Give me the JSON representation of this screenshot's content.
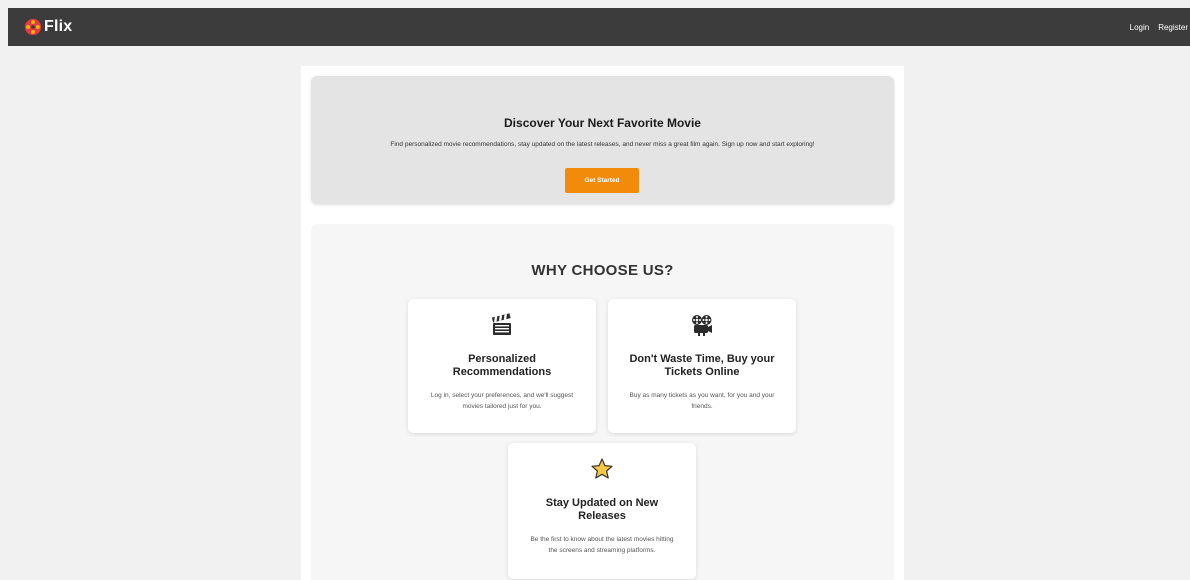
{
  "navbar": {
    "brand": "Flix",
    "links": [
      "Login",
      "Register"
    ]
  },
  "hero": {
    "title": "Discover Your Next Favorite Movie",
    "text": "Find personalized movie recommendations, stay updated on the latest releases, and never miss a great film again. Sign up now and start exploring!",
    "button_label": "Get Started",
    "button_color": "#f28b0a"
  },
  "features": {
    "title": "WHY CHOOSE US?",
    "cards": [
      {
        "icon": "clapperboard-icon",
        "title": "Personalized Recommendations",
        "text": "Log in, select your preferences, and we'll suggest movies tailored just for you."
      },
      {
        "icon": "film-projector-icon",
        "title": "Don't Waste Time, Buy your Tickets Online",
        "text": "Buy as many tickets as you want, for you and your friends."
      },
      {
        "icon": "star-icon",
        "title": "Stay Updated on New Releases",
        "text": "Be the first to know about the latest movies hitting the screens and streaming platforms."
      }
    ]
  }
}
